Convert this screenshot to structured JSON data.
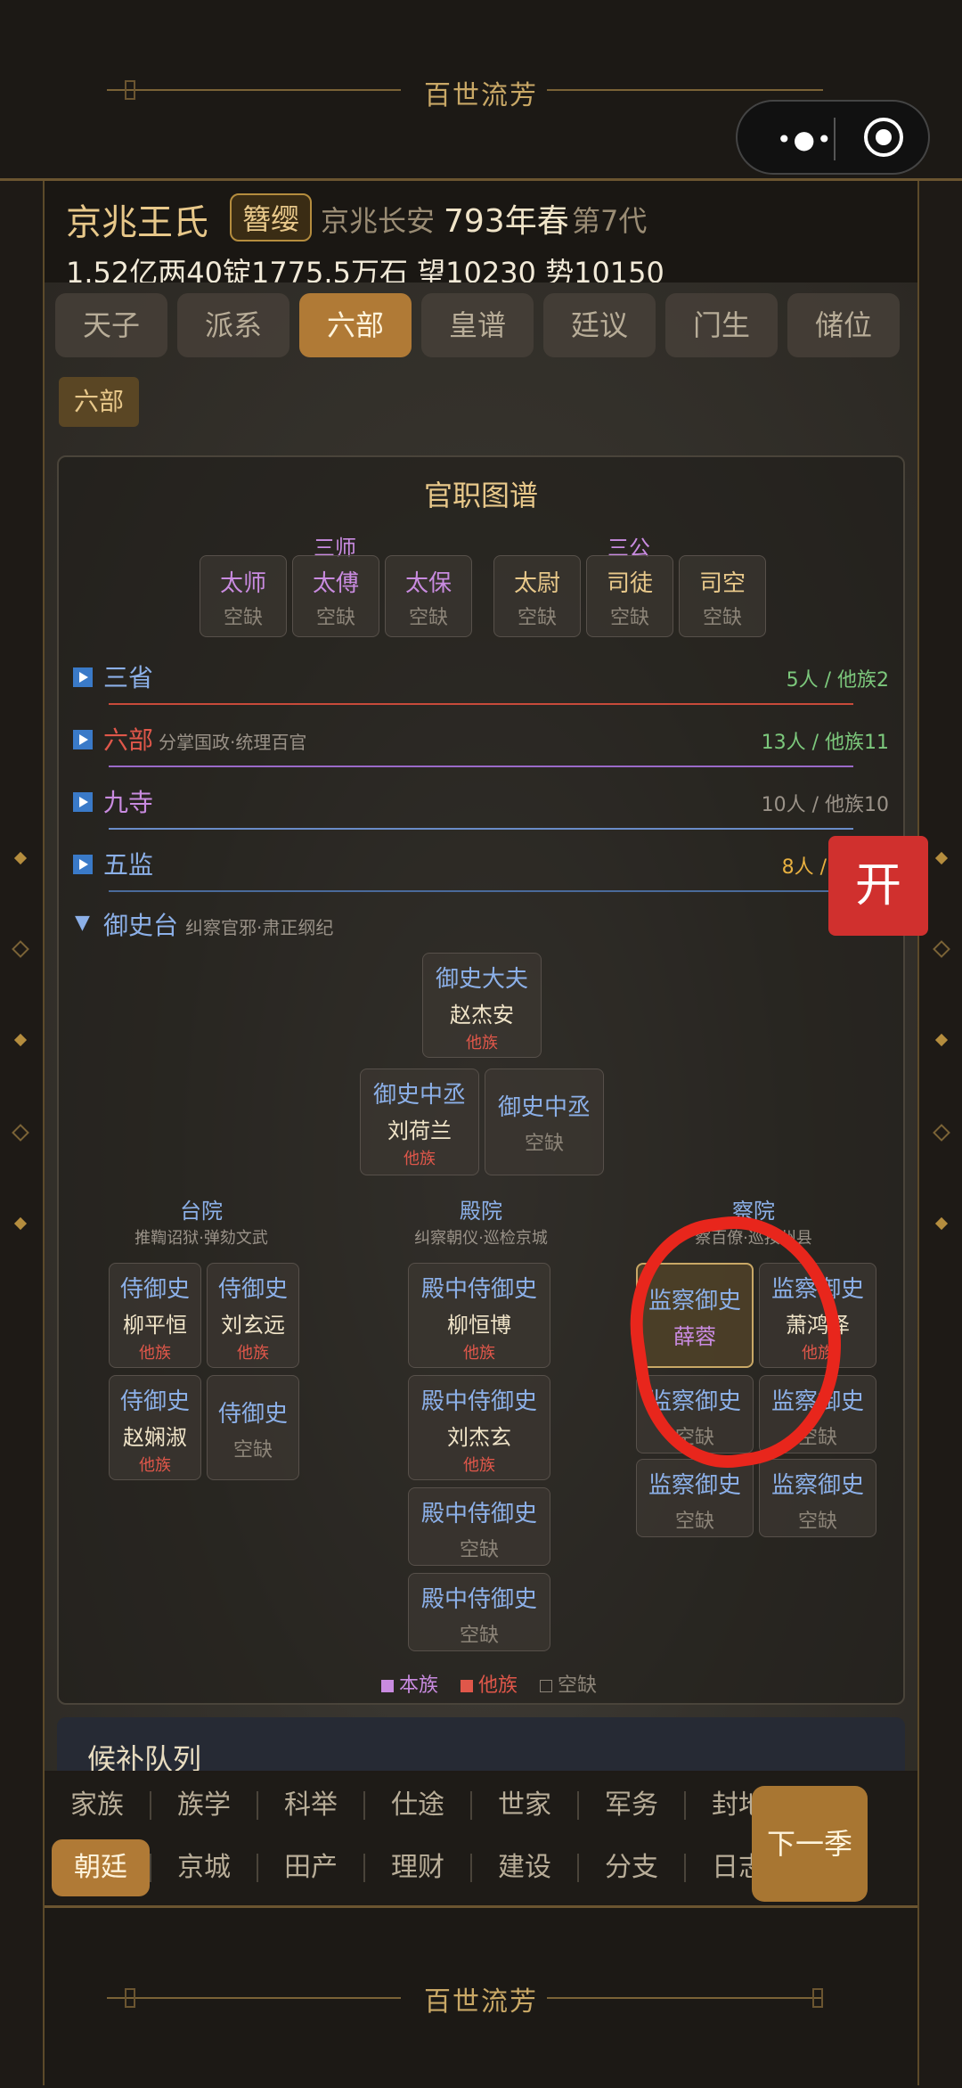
{
  "banner": {
    "title": "百世流芳"
  },
  "header": {
    "clan": "京兆王氏",
    "badge": "簪缨",
    "location": "京兆长安",
    "year": "793年春",
    "generation": "第7代",
    "stats": "1.52亿两40锭1775.5万石  望10230 势10150"
  },
  "tabs": [
    "天子",
    "派系",
    "六部",
    "皇谱",
    "廷议",
    "门生",
    "储位"
  ],
  "active_tab": "六部",
  "chip": "六部",
  "panel": {
    "title": "官职图谱",
    "sanshi": {
      "label": "三师",
      "items": [
        {
          "t": "太师",
          "s": "空缺"
        },
        {
          "t": "太傅",
          "s": "空缺"
        },
        {
          "t": "太保",
          "s": "空缺"
        }
      ]
    },
    "sangong": {
      "label": "三公",
      "items": [
        {
          "t": "太尉",
          "s": "空缺"
        },
        {
          "t": "司徒",
          "s": "空缺"
        },
        {
          "t": "司空",
          "s": "空缺"
        }
      ]
    },
    "rows": [
      {
        "name": "三省",
        "sub": "",
        "count": "5人 / 他族2",
        "color": "#8cb0e8",
        "count_color": "#7cc87c",
        "line": "#c84a3a"
      },
      {
        "name": "六部",
        "sub": "分掌国政·统理百官",
        "count": "13人 / 他族11",
        "color": "#e0574a",
        "count_color": "#7cc87c",
        "line": "#9a6ac8"
      },
      {
        "name": "九寺",
        "sub": "",
        "count": "10人 / 他族10",
        "color": "#c98be0",
        "count_color": "#9a9288",
        "line": "#6a8cc8"
      },
      {
        "name": "五监",
        "sub": "",
        "count": "8人 /",
        "count_color": "#e8b040",
        "color": "#8cb0e8",
        "line": "#4a6a9a"
      }
    ],
    "yushitai": {
      "name": "御史台",
      "sub": "纠察官邪·肃正纲纪"
    },
    "dafu": {
      "t": "御史大夫",
      "p": "赵杰安",
      "tag": "他族"
    },
    "zhongcheng": [
      {
        "t": "御史中丞",
        "p": "刘荷兰",
        "tag": "他族"
      },
      {
        "t": "御史中丞",
        "e": "空缺"
      }
    ],
    "taiyuan": {
      "name": "台院",
      "sub": "推鞫诏狱·弹劾文武",
      "nodes": [
        {
          "t": "侍御史",
          "p": "柳平恒",
          "tag": "他族"
        },
        {
          "t": "侍御史",
          "p": "刘玄远",
          "tag": "他族"
        },
        {
          "t": "侍御史",
          "p": "赵娴淑",
          "tag": "他族"
        },
        {
          "t": "侍御史",
          "e": "空缺"
        }
      ]
    },
    "dianyuan": {
      "name": "殿院",
      "sub": "纠察朝仪·巡检京城",
      "nodes": [
        {
          "t": "殿中侍御史",
          "p": "柳恒博",
          "tag": "他族"
        },
        {
          "t": "殿中侍御史",
          "p": "刘杰玄",
          "tag": "他族"
        },
        {
          "t": "殿中侍御史",
          "e": "空缺"
        },
        {
          "t": "殿中侍御史",
          "e": "空缺"
        }
      ]
    },
    "chayuan": {
      "name": "察院",
      "sub": "察百僚·巡按州县",
      "nodes": [
        {
          "t": "监察御史",
          "p": "薛蓉",
          "hl": true
        },
        {
          "t": "监察御史",
          "p": "萧鸿泽",
          "tag": "他族"
        },
        {
          "t": "监察御史",
          "e": "空缺"
        },
        {
          "t": "监察御史",
          "e": "空缺"
        },
        {
          "t": "监察御史",
          "e": "空缺"
        },
        {
          "t": "监察御史",
          "e": "空缺"
        }
      ]
    },
    "legend": [
      {
        "label": "本族",
        "color": "#c98be0"
      },
      {
        "label": "他族",
        "color": "#e0574a"
      },
      {
        "label": "空缺",
        "color": "#8c8478"
      }
    ]
  },
  "next_section": "候补队列",
  "float_button": "开",
  "nav_row1": [
    "家族",
    "族学",
    "科举",
    "仕途",
    "世家",
    "军务",
    "封地"
  ],
  "nav_row2": [
    "朝廷",
    "京城",
    "田产",
    "理财",
    "建设",
    "分支",
    "日志"
  ],
  "nav_active": "朝廷",
  "next_season": "下一季"
}
